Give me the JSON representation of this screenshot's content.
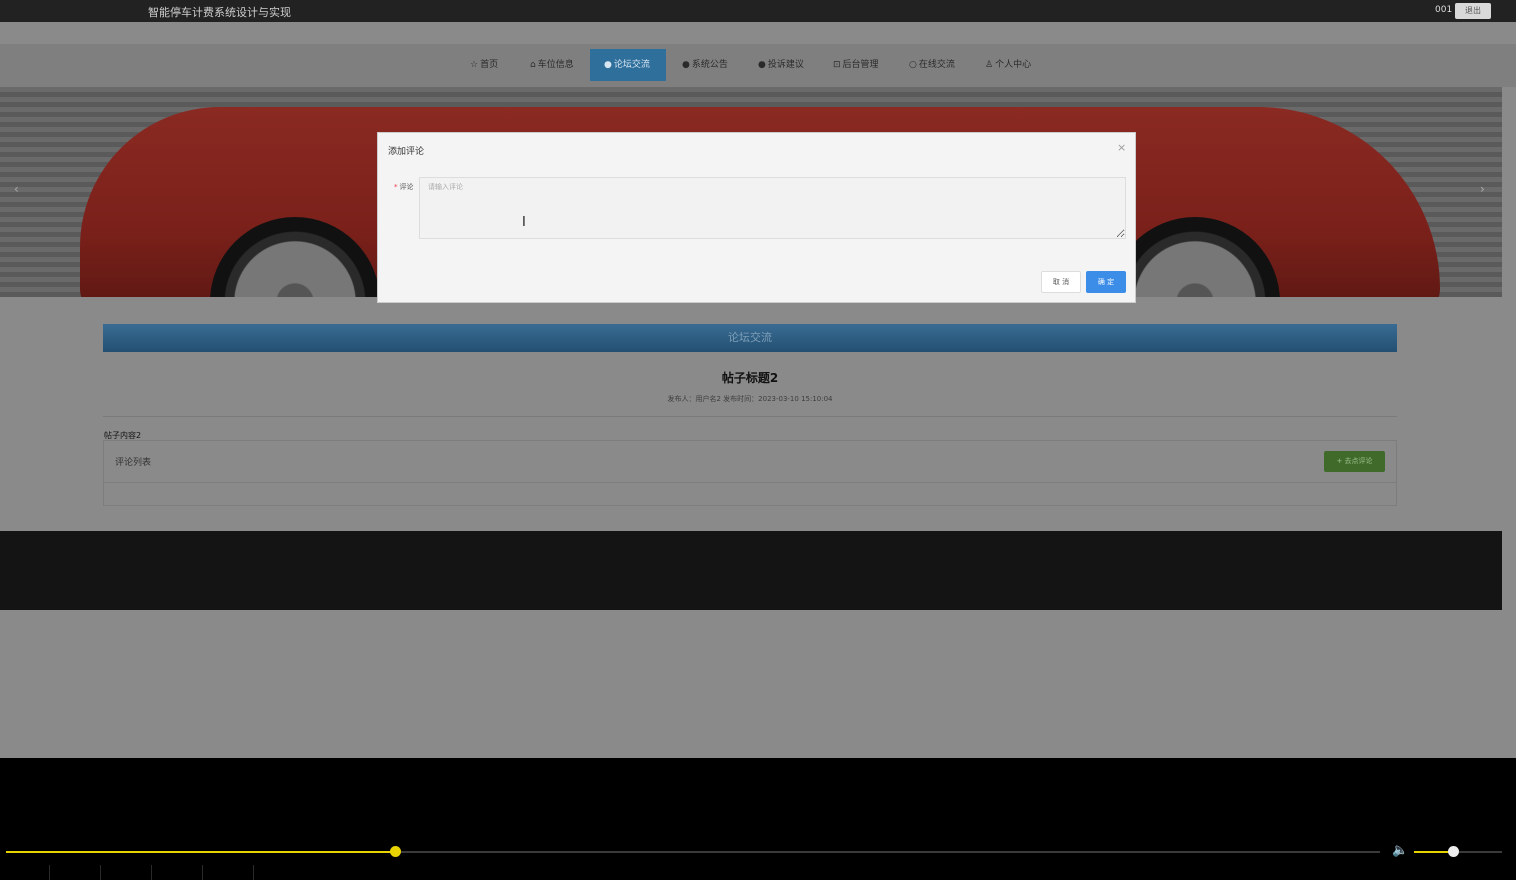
{
  "topbar": {
    "site_title": "智能停车计费系统设计与实现",
    "user": "001",
    "logout": "退出"
  },
  "nav": {
    "items": [
      {
        "icon": "☆",
        "label": "首页"
      },
      {
        "icon": "⌂",
        "label": "车位信息"
      },
      {
        "icon": "●",
        "label": "论坛交流",
        "active": true
      },
      {
        "icon": "●",
        "label": "系统公告"
      },
      {
        "icon": "●",
        "label": "投诉建议"
      },
      {
        "icon": "⊡",
        "label": "后台管理"
      },
      {
        "icon": "○",
        "label": "在线交流"
      },
      {
        "icon": "♙",
        "label": "个人中心"
      }
    ]
  },
  "banner": {
    "prev": "‹",
    "next": "›"
  },
  "section": {
    "title": "论坛交流"
  },
  "post": {
    "title": "帖子标题2",
    "meta": "发布人：用户名2  发布时间：2023-03-10 15:10:04",
    "content": "帖子内容2"
  },
  "comments": {
    "label": "评论列表",
    "add_button": "+ 去点评论"
  },
  "modal": {
    "title": "添加评论",
    "close": "×",
    "field_label": "评论",
    "required_mark": "*",
    "placeholder": "请输入评论",
    "value": "",
    "cancel": "取 消",
    "confirm": "确 定"
  },
  "player": {
    "progress": 0.283,
    "volume": 0.44,
    "volume_icon": "speaker-icon"
  },
  "colors": {
    "accent": "#e8d200",
    "nav_active": "#2f6f9c",
    "confirm_button": "#3b8de8",
    "add_comment_button": "#3f6a2a"
  }
}
